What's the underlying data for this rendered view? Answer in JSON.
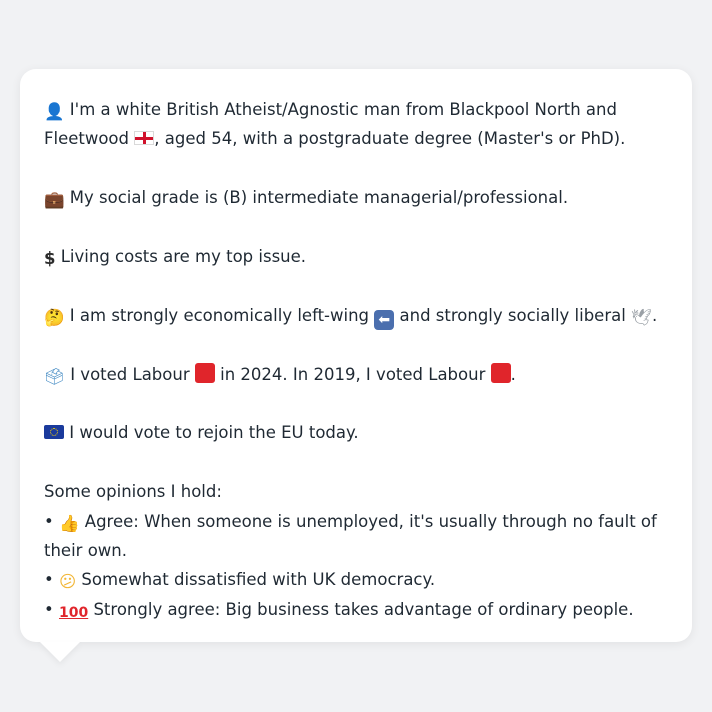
{
  "profile": {
    "line1": {
      "icon": "person-icon",
      "text_a": " I'm a white British Atheist/Agnostic man from Blackpool North and Fleetwood ",
      "flag": "england-flag-icon",
      "text_b": ", aged 54, with a postgraduate degree (Master's or PhD)."
    },
    "line2": {
      "icon": "briefcase-icon",
      "text": " My social grade is (B) intermediate managerial/professional."
    },
    "line3": {
      "icon": "dollar-icon",
      "text": " Living costs are my top issue."
    },
    "line4": {
      "icon": "thinking-face-icon",
      "text_a": " I am strongly economically left-wing ",
      "arrow_icon": "left-arrow-icon",
      "text_b": " and strongly socially liberal ",
      "dove_icon": "dove-icon",
      "text_c": "."
    },
    "line5": {
      "icon": "ballot-box-icon",
      "text_a": " I voted Labour ",
      "square_icon": "red-square-icon",
      "text_b": " in 2024. In 2019, I voted Labour ",
      "text_c": "."
    },
    "line6": {
      "icon": "eu-flag-icon",
      "text": " I would vote to rejoin the EU today."
    }
  },
  "opinions": {
    "heading": "Some opinions I hold:",
    "items": [
      {
        "bullet": "• ",
        "icon": "thumbs-up-icon",
        "text": " Agree: When someone is unemployed, it's usually through no fault of their own."
      },
      {
        "bullet": "• ",
        "icon": "confused-face-icon",
        "text": " Somewhat dissatisfied with UK democracy."
      },
      {
        "bullet": "• ",
        "icon": "hundred-points-icon",
        "text": " Strongly agree: Big business takes advantage of ordinary people."
      }
    ]
  },
  "colors": {
    "background": "#f1f2f4",
    "card": "#ffffff",
    "text": "#1f2933",
    "labour_red": "#e0252b"
  }
}
